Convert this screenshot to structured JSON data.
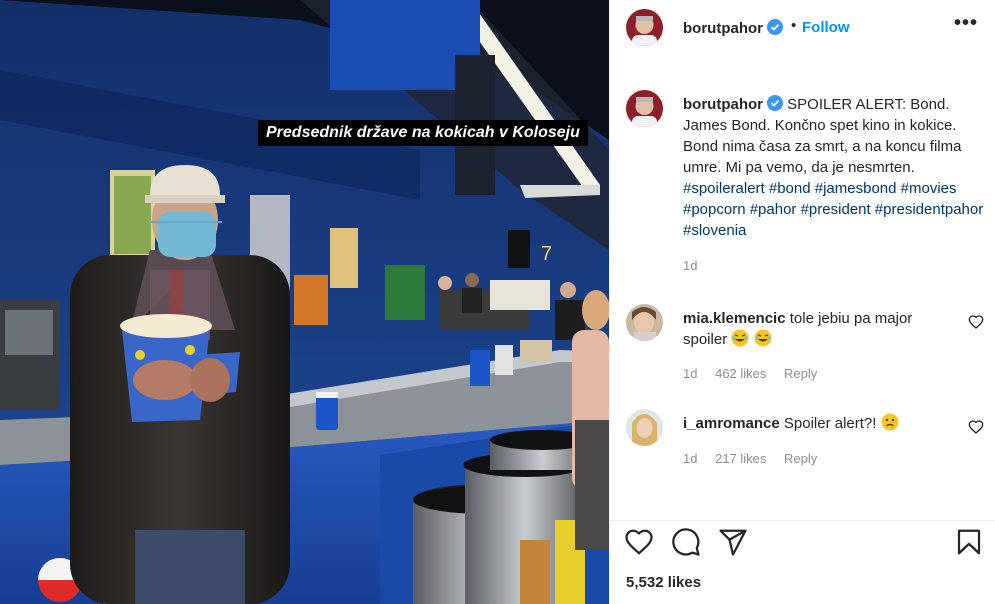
{
  "photo": {
    "caption": "Predsednik države na kokicah v Koloseju",
    "counter_number": "7"
  },
  "header": {
    "username": "borutpahor",
    "separator": "•",
    "follow_label": "Follow",
    "more_label": "•••"
  },
  "post": {
    "username": "borutpahor",
    "text": "SPOILER ALERT: Bond. James Bond. Končno spet kino in kokice. Bond nima časa za smrt, a na koncu filma umre. Mi pa vemo, da je nesmrten.",
    "hashtags": "#spoileralert #bond #jamesbond #movies #popcorn #pahor #president #presidentpahor #slovenia",
    "time": "1d"
  },
  "comments": [
    {
      "username": "mia.klemencic",
      "text": "tole jebiu pa major spoiler",
      "emojis": [
        "laughing-crying",
        "laughing-crying"
      ],
      "time": "1d",
      "likes": "462 likes",
      "reply": "Reply"
    },
    {
      "username": "i_amromance",
      "text": "Spoiler alert?!",
      "emojis": [
        "sad-face"
      ],
      "time": "1d",
      "likes": "217 likes",
      "reply": "Reply"
    }
  ],
  "actions": {
    "icons": [
      "heart-icon",
      "comment-icon",
      "share-icon",
      "bookmark-icon"
    ],
    "likes": "5,532 likes"
  },
  "colors": {
    "accent": "#0095f6",
    "hashtag": "#00376b",
    "muted": "#8e8e8e",
    "verified": "#3897f0",
    "wall_blue": "#1d3f86"
  }
}
